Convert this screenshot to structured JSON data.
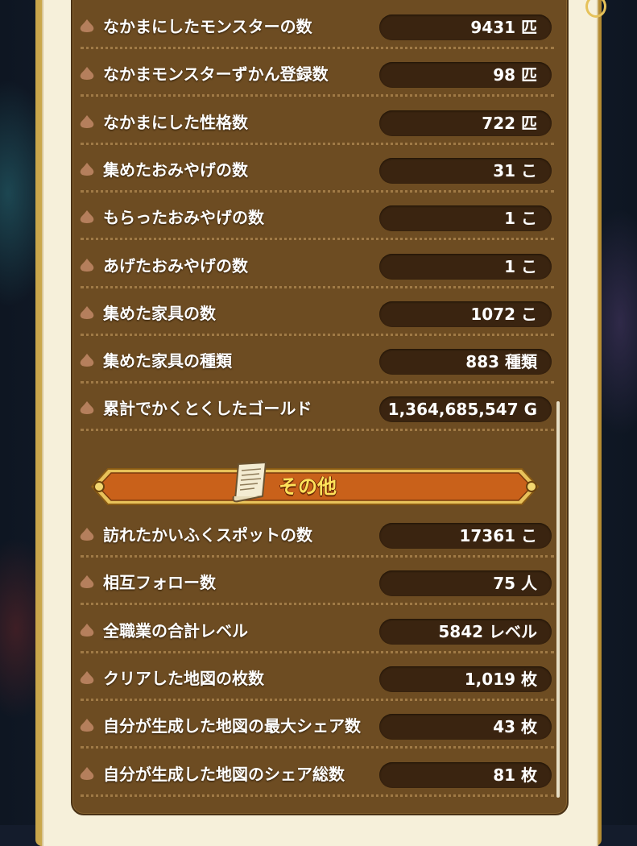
{
  "rows_top": [
    {
      "label": "なかまにしたモンスターの数",
      "value": "9431 匹"
    },
    {
      "label": "なかまモンスターずかん登録数",
      "value": "98 匹"
    },
    {
      "label": "なかまにした性格数",
      "value": "722 匹"
    },
    {
      "label": "集めたおみやげの数",
      "value": "31 こ"
    },
    {
      "label": "もらったおみやげの数",
      "value": "1 こ"
    },
    {
      "label": "あげたおみやげの数",
      "value": "1 こ"
    },
    {
      "label": "集めた家具の数",
      "value": "1072 こ"
    },
    {
      "label": "集めた家具の種類",
      "value": "883 種類"
    },
    {
      "label": "累計でかくとくしたゴールド",
      "value": "1,364,685,547 G"
    }
  ],
  "section": {
    "title": "その他",
    "icon": "scroll-icon"
  },
  "rows_bottom": [
    {
      "label": "訪れたかいふくスポットの数",
      "value": "17361 こ"
    },
    {
      "label": "相互フォロー数",
      "value": "75 人"
    },
    {
      "label": "全職業の合計レベル",
      "value": "5842 レベル"
    },
    {
      "label": "クリアした地図の枚数",
      "value": "1,019 枚"
    },
    {
      "label": "自分が生成した地図の最大シェア数",
      "value": "43 枚"
    },
    {
      "label": "自分が生成した地図のシェア総数",
      "value": "81 枚"
    }
  ],
  "colors": {
    "panel": "#6d4c22",
    "pill": "#3a2410",
    "banner": "#d2661a",
    "gold": "#e6c25a"
  }
}
